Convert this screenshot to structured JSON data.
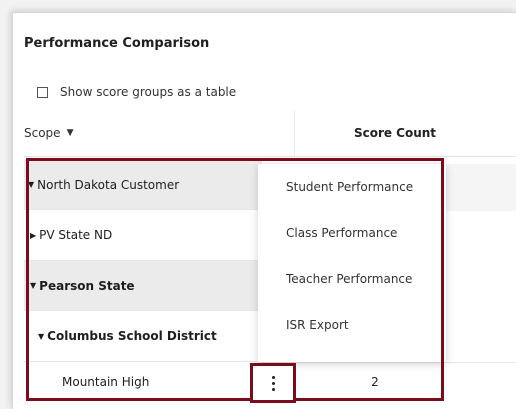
{
  "panel": {
    "title": "Performance Comparison",
    "show_table_label": "Show score groups as a table",
    "show_table_checked": false
  },
  "table": {
    "scope_header": "Scope",
    "score_header": "Score Count",
    "rows": [
      {
        "label": "North Dakota Customer",
        "expanded": true
      },
      {
        "label": "PV State ND",
        "expanded": false
      },
      {
        "label": "Pearson State",
        "expanded": true
      },
      {
        "label": "Columbus School District",
        "expanded": true
      },
      {
        "label": "Mountain High",
        "score": "2"
      }
    ]
  },
  "context_menu": {
    "items": [
      "Student Performance",
      "Class Performance",
      "Teacher Performance",
      "ISR Export"
    ]
  },
  "colors": {
    "highlight": "#7a0c1c",
    "row_shaded": "#ebebeb"
  }
}
